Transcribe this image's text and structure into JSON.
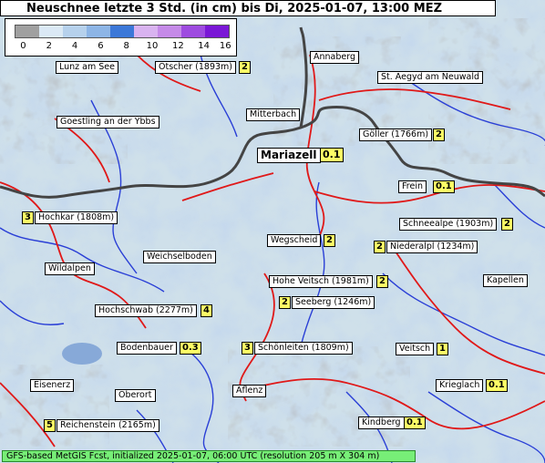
{
  "title": "Neuschnee letzte 3 Std. (in cm) bis Di, 2025-01-07, 13:00 MEZ",
  "legend": {
    "ticks": [
      "0",
      "2",
      "4",
      "6",
      "8",
      "10",
      "12",
      "14",
      "16"
    ],
    "colors": [
      "#a0a0a0",
      "#dbe9f5",
      "#b6d1ec",
      "#8db5e6",
      "#3c78d8",
      "#d9b3f0",
      "#c58ae8",
      "#9e4be0",
      "#7a17d6"
    ]
  },
  "places": [
    {
      "name": "Lunz am See"
    },
    {
      "name": "Ötscher (1893m)",
      "value": "2"
    },
    {
      "name": "Annaberg"
    },
    {
      "name": "St. Aegyd am Neuwald"
    },
    {
      "name": "Goestling an der Ybbs"
    },
    {
      "name": "Mitterbach"
    },
    {
      "name": "Göller (1766m)",
      "value": "2"
    },
    {
      "name": "Mariazell",
      "value": "0.1"
    },
    {
      "name": "Frein",
      "value": "0.1"
    },
    {
      "name": "Hochkar (1808m)",
      "value": "3"
    },
    {
      "name": "Schneealpe (1903m)",
      "value": "2"
    },
    {
      "name": "Wegscheid",
      "value": "2"
    },
    {
      "name": "Niederalpl (1234m)",
      "value": "2"
    },
    {
      "name": "Weichselboden"
    },
    {
      "name": "Wildalpen"
    },
    {
      "name": "Hohe Veitsch (1981m)",
      "value": "2"
    },
    {
      "name": "Kapellen"
    },
    {
      "name": "Seeberg (1246m)",
      "value": "2"
    },
    {
      "name": "Hochschwab (2277m)",
      "value": "4"
    },
    {
      "name": "Bodenbauer",
      "value": "0.3"
    },
    {
      "name": "Schönleiten (1809m)",
      "value": "3"
    },
    {
      "name": "Veitsch",
      "value": "1"
    },
    {
      "name": "Eisenerz"
    },
    {
      "name": "Oberort"
    },
    {
      "name": "Aflenz"
    },
    {
      "name": "Krieglach",
      "value": "0.1"
    },
    {
      "name": "Reichenstein (2165m)",
      "value": "5"
    },
    {
      "name": "Kindberg",
      "value": "0.1"
    }
  ],
  "footer": "GFS-based MetGIS Fcst, initialized 2025-01-07, 06:00 UTC  (resolution 205 m X 304 m)"
}
